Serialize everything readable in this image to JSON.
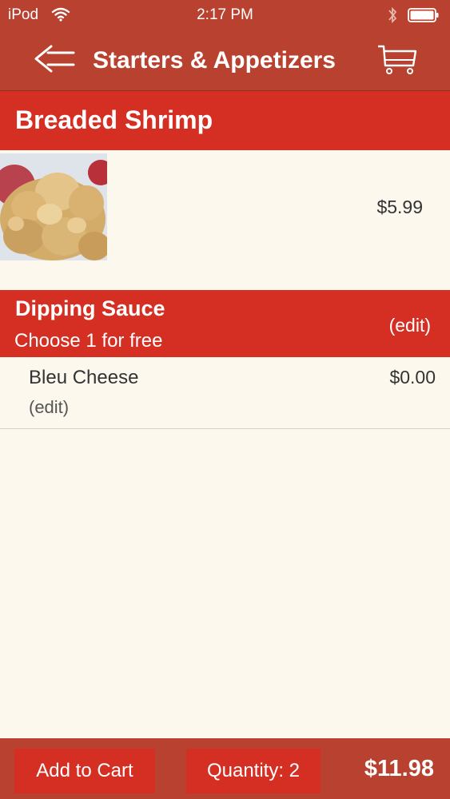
{
  "status_bar": {
    "carrier": "iPod",
    "time": "2:17 PM",
    "icons": [
      "wifi-icon",
      "bluetooth-icon",
      "battery-icon"
    ]
  },
  "nav": {
    "title": "Starters & Appetizers",
    "back_icon": "back-arrow-icon",
    "cart_icon": "shopping-cart-icon"
  },
  "item": {
    "name": "Breaded Shrimp",
    "price": "$5.99",
    "image": "breaded-shrimp-photo"
  },
  "option_group": {
    "title": "Dipping Sauce",
    "subtitle": "Choose 1 for free",
    "edit_label": "(edit)"
  },
  "option_selection": {
    "name": "Bleu Cheese",
    "price": "$0.00",
    "edit_label": "(edit)"
  },
  "bottom_bar": {
    "add_to_cart_label": "Add to Cart",
    "quantity_label": "Quantity: 2",
    "total": "$11.98"
  },
  "colors": {
    "bar_red": "#b8412f",
    "accent_red": "#d42f22",
    "background": "#fcf8ee"
  }
}
